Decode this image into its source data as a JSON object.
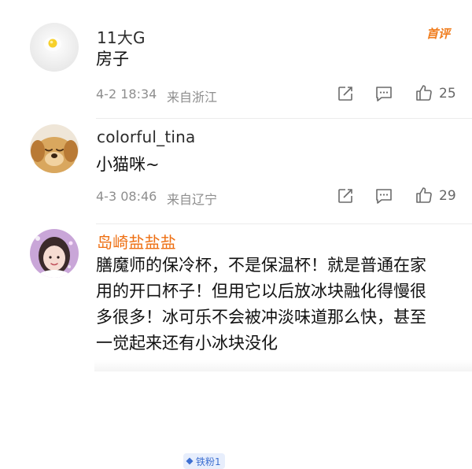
{
  "hot_badge": "首评",
  "comments": [
    {
      "username": "11大G",
      "content_lines": [
        "房子"
      ],
      "time": "4-2 18:34",
      "location": "来自浙江",
      "likes": "25",
      "avatar_icon": "fried-egg-avatar"
    },
    {
      "username": "colorful_tina",
      "content_lines": [
        "小猫咪~"
      ],
      "time": "4-3 08:46",
      "location": "来自辽宁",
      "likes": "29",
      "avatar_icon": "puppy-avatar"
    },
    {
      "username": "岛崎盐盐盐",
      "fan_badge": "铁粉1",
      "content_lines": [
        "膳魔师的保冷杯，不是保温杯！就是普通在家",
        "用的开口杯子！但用它以后放冰块融化得慢很",
        "多很多！冰可乐不会被冲淡味道那么快，甚至",
        "一觉起来还有小冰块没化"
      ],
      "avatar_icon": "girl-avatar"
    }
  ],
  "colors": {
    "username_highlight": "#ee6f12",
    "meta_text": "#8e8e8e",
    "hot_badge": "#f07d1e",
    "fan_badge_text": "#3d6fd1"
  }
}
